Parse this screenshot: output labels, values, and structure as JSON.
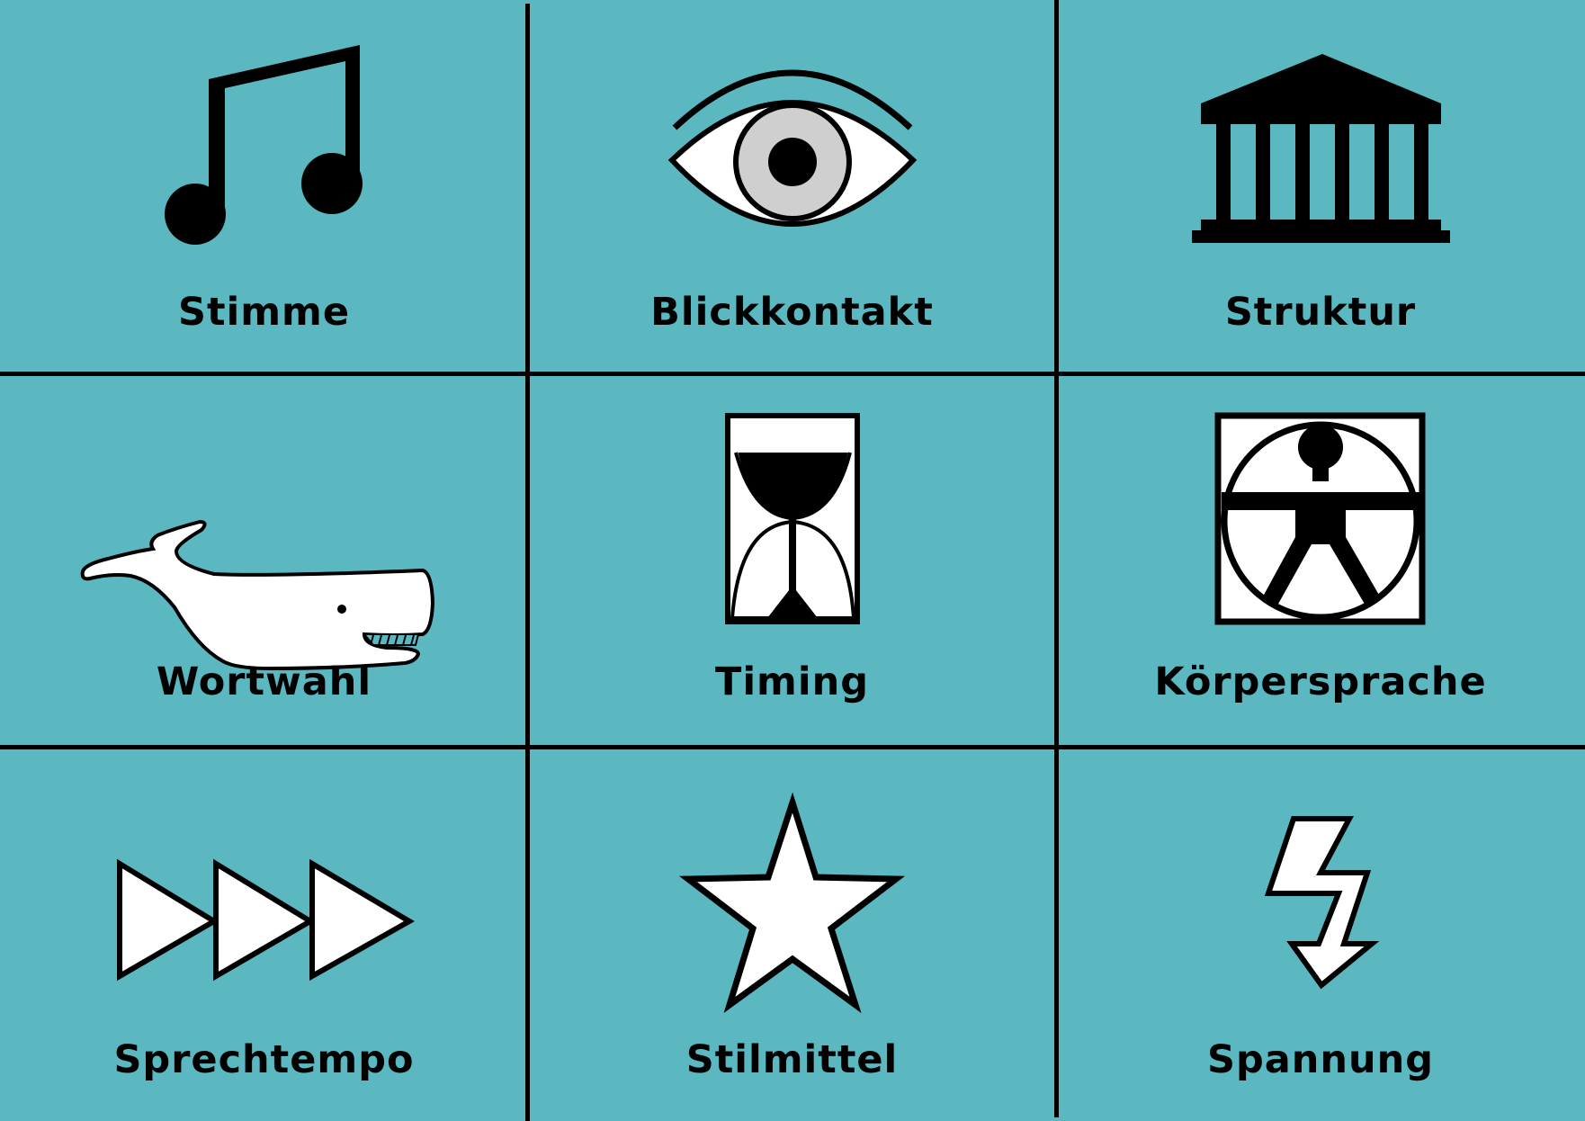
{
  "board": {
    "background": "#5bb8c1",
    "tiles": [
      {
        "label": "Stimme",
        "icon": "music-notes-icon"
      },
      {
        "label": "Blickkontakt",
        "icon": "eye-icon"
      },
      {
        "label": "Struktur",
        "icon": "temple-icon"
      },
      {
        "label": "Wortwahl",
        "icon": "whale-icon"
      },
      {
        "label": "Timing",
        "icon": "hourglass-icon"
      },
      {
        "label": "Körpersprache",
        "icon": "vitruvian-man-icon"
      },
      {
        "label": "Sprechtempo",
        "icon": "fast-forward-icon"
      },
      {
        "label": "Stilmittel",
        "icon": "star-icon"
      },
      {
        "label": "Spannung",
        "icon": "lightning-icon"
      }
    ]
  }
}
